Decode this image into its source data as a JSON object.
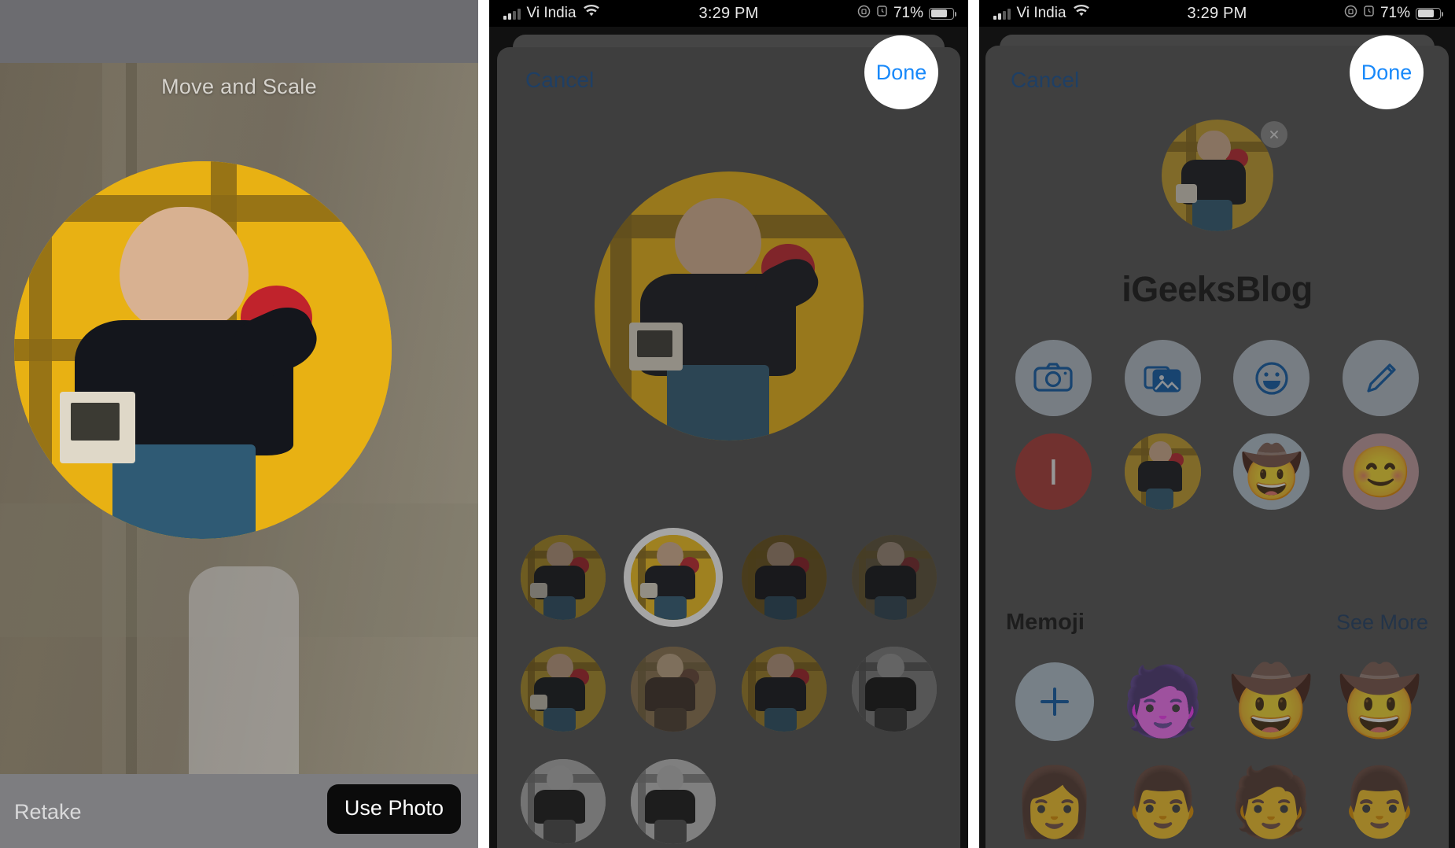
{
  "status_bar": {
    "carrier": "Vi India",
    "time": "3:29 PM",
    "battery_percent": "71%",
    "signal_icon": "cellular-signal-icon",
    "wifi_icon": "wifi-icon",
    "orientation_lock_icon": "rotation-lock-icon",
    "alarm_icon": "alarm-clock-icon",
    "battery_icon": "battery-icon"
  },
  "panel1": {
    "title": "Move and Scale",
    "retake_label": "Retake",
    "use_photo_label": "Use Photo",
    "crop_circle_name": "crop-circle"
  },
  "panel2": {
    "cancel_label": "Cancel",
    "done_label": "Done",
    "preview_name": "photo-preview",
    "filters": [
      {
        "id": "filter-1",
        "selected": false,
        "tint": "warm-gold-dim"
      },
      {
        "id": "filter-2",
        "selected": true,
        "tint": "vivid-yellow"
      },
      {
        "id": "filter-3",
        "selected": false,
        "tint": "warm-dark"
      },
      {
        "id": "filter-4",
        "selected": false,
        "tint": "cool-dark"
      },
      {
        "id": "filter-5",
        "selected": false,
        "tint": "gold"
      },
      {
        "id": "filter-6",
        "selected": false,
        "tint": "sepia"
      },
      {
        "id": "filter-7",
        "selected": false,
        "tint": "amber"
      },
      {
        "id": "filter-8",
        "selected": false,
        "tint": "mono-dark"
      },
      {
        "id": "filter-9",
        "selected": false,
        "tint": "mono-light"
      },
      {
        "id": "filter-10",
        "selected": false,
        "tint": "mono-silver"
      }
    ]
  },
  "panel3": {
    "cancel_label": "Cancel",
    "done_label": "Done",
    "profile_name": "iGeeksBlog",
    "avatar_name": "profile-avatar",
    "close_label": "×",
    "actions_row1": [
      {
        "icon": "camera-icon",
        "label": "Camera"
      },
      {
        "icon": "photos-icon",
        "label": "Photos"
      },
      {
        "icon": "memoji-smiley-icon",
        "label": "Memoji"
      },
      {
        "icon": "pencil-icon",
        "label": "Monogram"
      }
    ],
    "actions_row2": [
      {
        "icon": "monogram-avatar",
        "letter": "I",
        "color": "#ae3a35"
      },
      {
        "icon": "photo-avatar",
        "label": "Photo"
      },
      {
        "icon": "memoji-avatar-cowboy",
        "glyph": "🤠"
      },
      {
        "icon": "emoji-avatar-smile",
        "glyph": "😊"
      }
    ],
    "section": {
      "title": "Memoji",
      "see_more_label": "See More"
    },
    "memoji": [
      {
        "icon": "add-memoji-icon",
        "glyph": "+"
      },
      {
        "icon": "memoji-purple-face",
        "glyph": "🧑"
      },
      {
        "icon": "memoji-cowboy-hat-1",
        "glyph": "🤠"
      },
      {
        "icon": "memoji-cowboy-hat-2",
        "glyph": "🤠"
      },
      {
        "icon": "memoji-beanie-girl",
        "glyph": "👩"
      },
      {
        "icon": "memoji-glasses-man",
        "glyph": "👨"
      },
      {
        "icon": "memoji-beanie-man",
        "glyph": "🧑"
      },
      {
        "icon": "memoji-glasses-brown-hair",
        "glyph": "👨"
      }
    ]
  },
  "colors": {
    "ios_blue": "#1989fa",
    "link_blue": "#1f3f64",
    "sheet_gray": "#4e4e4e",
    "accent_yellow": "#e8b113",
    "red_monogram": "#ae3a35"
  }
}
